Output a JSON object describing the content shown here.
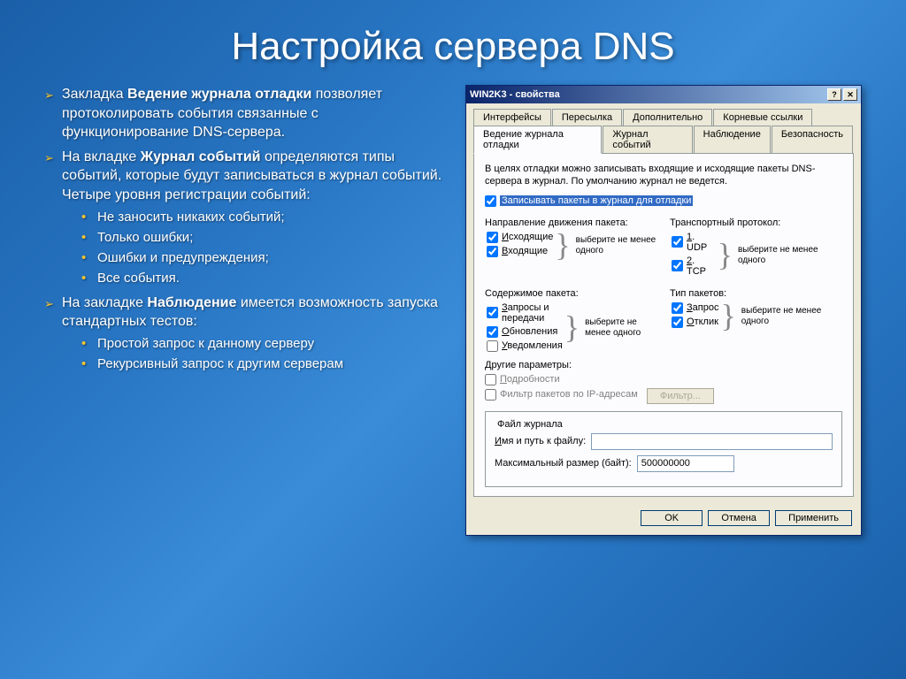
{
  "slide": {
    "title": "Настройка сервера DNS",
    "bullet1_pre": "Закладка ",
    "bullet1_bold": "Ведение журнала отладки",
    "bullet1_post": " позволяет протоколировать события связанные с функционирование DNS-сервера.",
    "bullet2_pre": "На вкладке ",
    "bullet2_bold": "Журнал событий",
    "bullet2_post": " определяются типы событий, которые будут записываться в журнал событий. Четыре уровня регистрации событий:",
    "sub2_1": "Не заносить никаких событий;",
    "sub2_2": "Только ошибки;",
    "sub2_3": "Ошибки и предупреждения;",
    "sub2_4": "Все события.",
    "bullet3_pre": "На закладке ",
    "bullet3_bold": "Наблюдение",
    "bullet3_post": " имеется возможность запуска стандартных тестов:",
    "sub3_1": "Простой запрос  к данному серверу",
    "sub3_2": "Рекурсивный запрос к другим серверам"
  },
  "dialog": {
    "title": "WIN2K3 - свойства",
    "tabs_row1": [
      "Интерфейсы",
      "Пересылка",
      "Дополнительно",
      "Корневые ссылки"
    ],
    "tabs_row2": [
      "Ведение журнала отладки",
      "Журнал событий",
      "Наблюдение",
      "Безопасность"
    ],
    "active_tab": "Ведение журнала отладки",
    "desc": "В целях отладки можно записывать входящие и исходящие пакеты DNS-сервера в журнал. По умолчанию журнал не ведется.",
    "main_check": "Записывать пакеты в журнал для отладки",
    "direction_label": "Направление движения пакета:",
    "outgoing": "Исходящие",
    "incoming": "Входящие",
    "transport_label": "Транспортный протокол:",
    "udp": "1. UDP",
    "tcp": "2. TCP",
    "content_label": "Содержимое пакета:",
    "queries": "Запросы и передачи",
    "updates": "Обновления",
    "notifications": "Уведомления",
    "type_label": "Тип пакетов:",
    "request": "Запрос",
    "response": "Отклик",
    "hint": "выберите не менее одного",
    "other_label": "Другие параметры:",
    "details": "Подробности",
    "ip_filter": "Фильтр пакетов по IP-адресам",
    "filter_btn": "Фильтр...",
    "file_group": "Файл журнала",
    "path_label": "Имя и путь к файлу:",
    "path_value": "",
    "size_label": "Максимальный размер (байт):",
    "size_value": "500000000",
    "ok": "OK",
    "cancel": "Отмена",
    "apply": "Применить"
  }
}
